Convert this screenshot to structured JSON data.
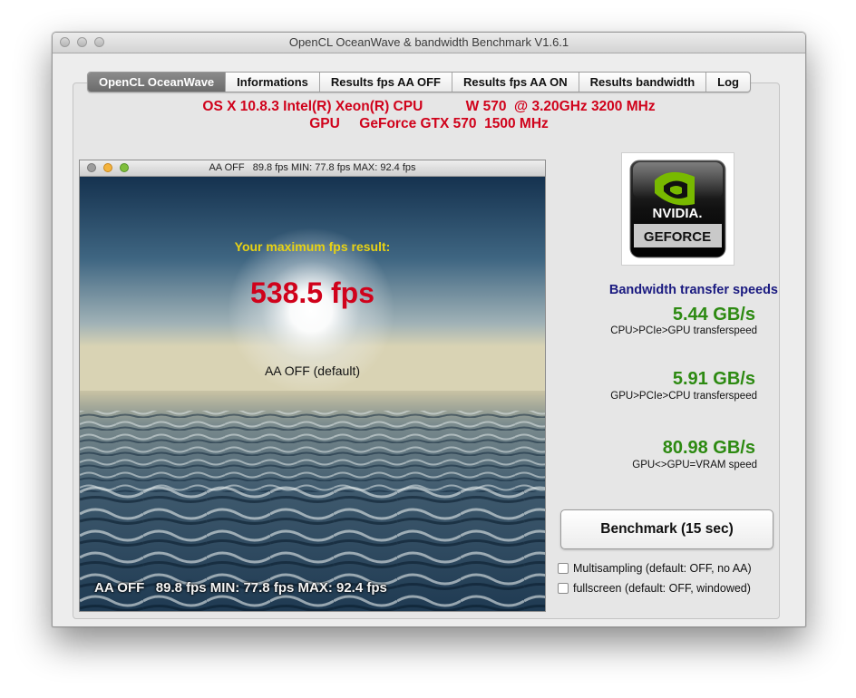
{
  "window": {
    "title": "OpenCL OceanWave & bandwidth Benchmark V1.6.1"
  },
  "tabs": [
    {
      "label": "OpenCL OceanWave",
      "active": true
    },
    {
      "label": "Informations",
      "active": false
    },
    {
      "label": "Results fps AA OFF",
      "active": false
    },
    {
      "label": "Results fps AA ON",
      "active": false
    },
    {
      "label": "Results bandwidth",
      "active": false
    },
    {
      "label": "Log",
      "active": false
    }
  ],
  "system": {
    "cpu_line": "OS X 10.8.3 Intel(R) Xeon(R) CPU           W 570  @ 3.20GHz 3200 MHz",
    "gpu_line": "GPU     GeForce GTX 570  1500 MHz"
  },
  "render_window": {
    "title": "AA OFF   89.8 fps MIN: 77.8 fps MAX: 92.4 fps",
    "result_caption": "Your maximum fps result:",
    "result_value": "538.5 fps",
    "mode_label": "AA OFF (default)",
    "status_overlay": "AA OFF   89.8 fps MIN: 77.8 fps MAX: 92.4 fps"
  },
  "logo": {
    "brand": "NVIDIA",
    "product": "GEFORCE",
    "icon": "nvidia-eye-icon"
  },
  "bandwidth": {
    "title": "Bandwidth transfer speeds",
    "items": [
      {
        "value": "5.44 GB/s",
        "label": "CPU>PCIe>GPU transferspeed"
      },
      {
        "value": "5.91 GB/s",
        "label": "GPU>PCIe>CPU transferspeed"
      },
      {
        "value": "80.98 GB/s",
        "label": "GPU<>GPU=VRAM speed"
      }
    ]
  },
  "controls": {
    "benchmark_label": "Benchmark  (15 sec)",
    "multisampling_label": "Multisampling (default: OFF, no AA)",
    "fullscreen_label": "fullscreen (default: OFF, windowed)",
    "multisampling_checked": false,
    "fullscreen_checked": false
  },
  "colors": {
    "system_text": "#d0021b",
    "fps_value": "#d0021b",
    "caption_yellow": "#e8d214",
    "bandwidth_title": "#1a1a80",
    "bandwidth_value": "#2d8a12"
  }
}
